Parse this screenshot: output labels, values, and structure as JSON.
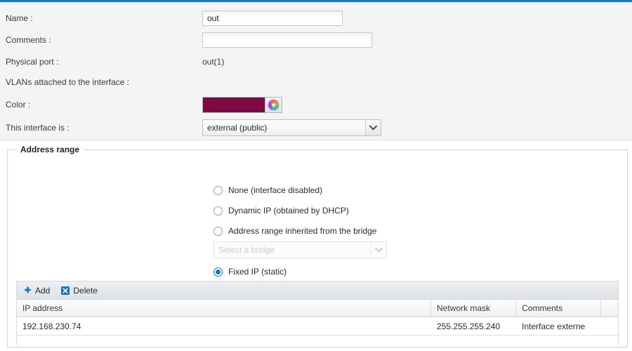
{
  "theme": {
    "accent_blue": "#1a79bd",
    "panel_bg": "#f4f4f4",
    "radio_selected": "#1277c4",
    "interface_color": "#7d0a42"
  },
  "properties": {
    "name": {
      "label": "Name :",
      "value": "out",
      "placeholder": ""
    },
    "comments": {
      "label": "Comments :",
      "value": "",
      "placeholder": ""
    },
    "physical_port": {
      "label": "Physical port :",
      "value": "out(1)"
    },
    "vlans": {
      "label": "VLANs attached to the interface :",
      "value": ""
    },
    "color": {
      "label": "Color :",
      "swatch_hex": "#7d0a42",
      "picker_icon": "color-wheel-icon"
    },
    "interface_type": {
      "label": "This interface is :",
      "selected": "external (public)",
      "arrow_icon": "chevron-down-icon"
    }
  },
  "address_range": {
    "legend": "Address range",
    "options": [
      {
        "label": "None (interface disabled)",
        "checked": false
      },
      {
        "label": "Dynamic IP (obtained by DHCP)",
        "checked": false
      },
      {
        "label": "Address range inherited from the bridge",
        "checked": false
      },
      {
        "label": "Fixed IP (static)",
        "checked": true
      }
    ],
    "bridge_select": {
      "placeholder": "Select a bridge",
      "value": "",
      "disabled": true,
      "arrow_icon": "chevron-down-icon"
    },
    "grid": {
      "toolbar": {
        "add_label": "Add",
        "add_icon": "plus-icon",
        "delete_label": "Delete",
        "delete_icon": "delete-x-icon"
      },
      "columns": [
        "IP address",
        "Network mask",
        "Comments"
      ],
      "rows": [
        {
          "ip_address": "192.168.230.74",
          "network_mask": "255.255.255.240",
          "comments": "Interface externe"
        }
      ]
    }
  }
}
